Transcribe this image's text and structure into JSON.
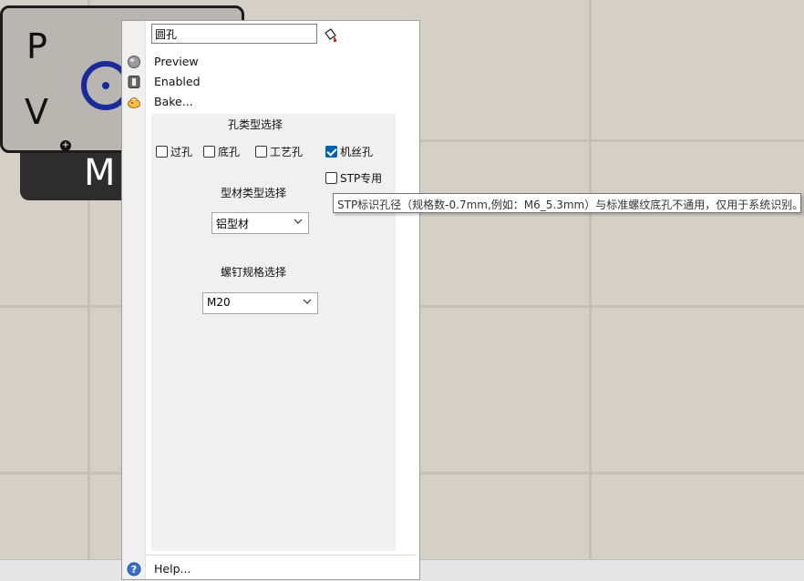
{
  "node": {
    "input_p": "P",
    "input_v": "V",
    "output_m": "M"
  },
  "menu": {
    "name_value": "圆孔",
    "items": {
      "preview": "Preview",
      "enabled": "Enabled",
      "bake": "Bake...",
      "help": "Help..."
    }
  },
  "panel": {
    "hole_type_title": "孔类型选择",
    "hole_types": [
      {
        "label": "过孔",
        "checked": false
      },
      {
        "label": "底孔",
        "checked": false
      },
      {
        "label": "工艺孔",
        "checked": false
      },
      {
        "label": "机丝孔",
        "checked": true
      },
      {
        "label": "STP专用",
        "checked": false
      }
    ],
    "profile_type_title": "型材类型选择",
    "profile_type_value": "铝型材",
    "screw_spec_title": "螺钉规格选择",
    "screw_spec_value": "M20"
  },
  "tooltip": {
    "text": "STP标识孔径（规格数-0.7mm,例如：M6_5.3mm）与标准螺纹底孔不通用，仅用于系统识别。"
  },
  "colors": {
    "canvas": "#d4d0c8",
    "accent_check": "#0063b1",
    "node_icon": "#1a2a9a"
  }
}
